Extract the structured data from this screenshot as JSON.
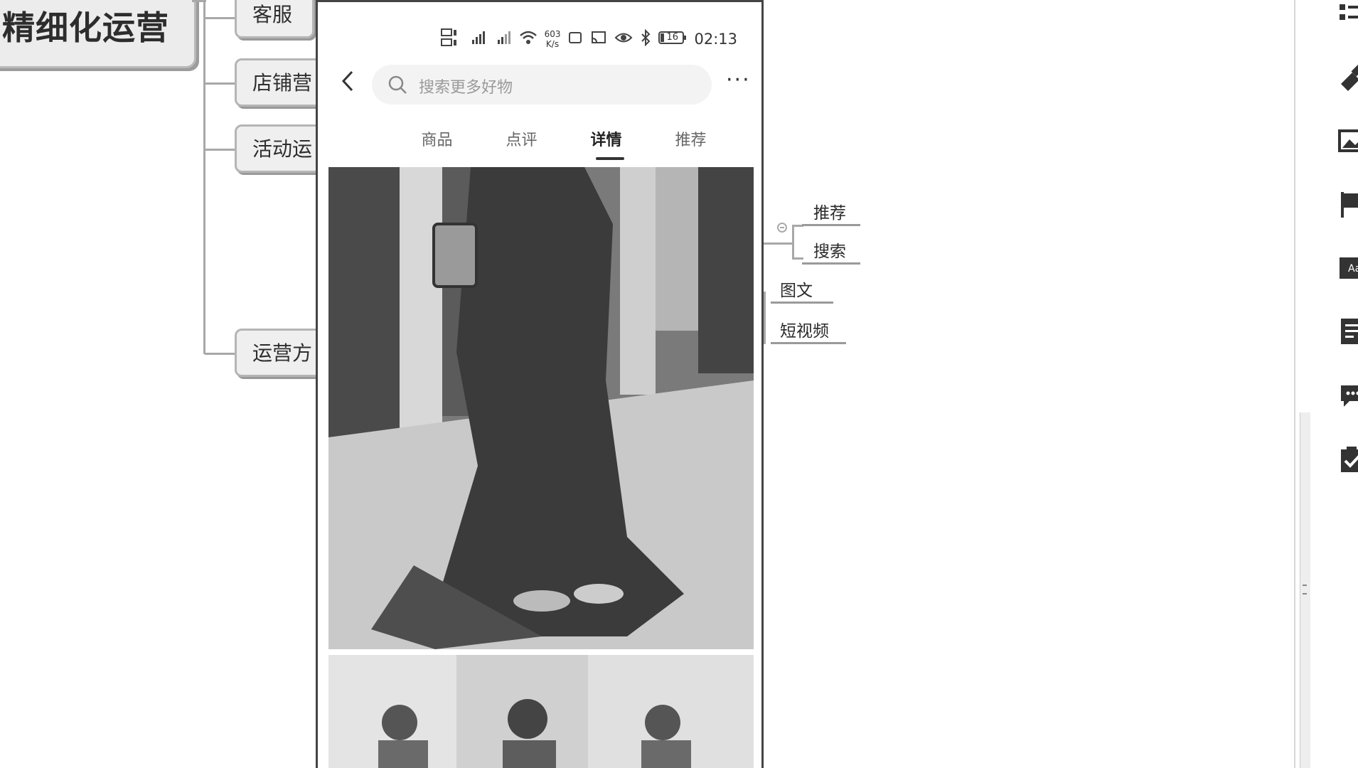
{
  "mindmap": {
    "root": "精细化运营",
    "branches": [
      "客服",
      "店铺营",
      "活动运",
      "运营方"
    ],
    "sub_nodes": [
      "推荐",
      "搜索",
      "图文",
      "短视频"
    ]
  },
  "phone": {
    "status": {
      "time": "02:13",
      "net_speed": "603",
      "net_unit": "K/s",
      "battery": "16"
    },
    "search": {
      "placeholder": "搜索更多好物"
    },
    "more_label": "···",
    "tabs": [
      {
        "label": "商品"
      },
      {
        "label": "点评"
      },
      {
        "label": "详情",
        "active": true
      },
      {
        "label": "推荐"
      }
    ]
  },
  "toolbar_icons": [
    "outline-icon",
    "brush-icon",
    "image-icon",
    "flag-icon",
    "text-style-icon",
    "notes-icon",
    "comment-icon",
    "task-icon"
  ]
}
